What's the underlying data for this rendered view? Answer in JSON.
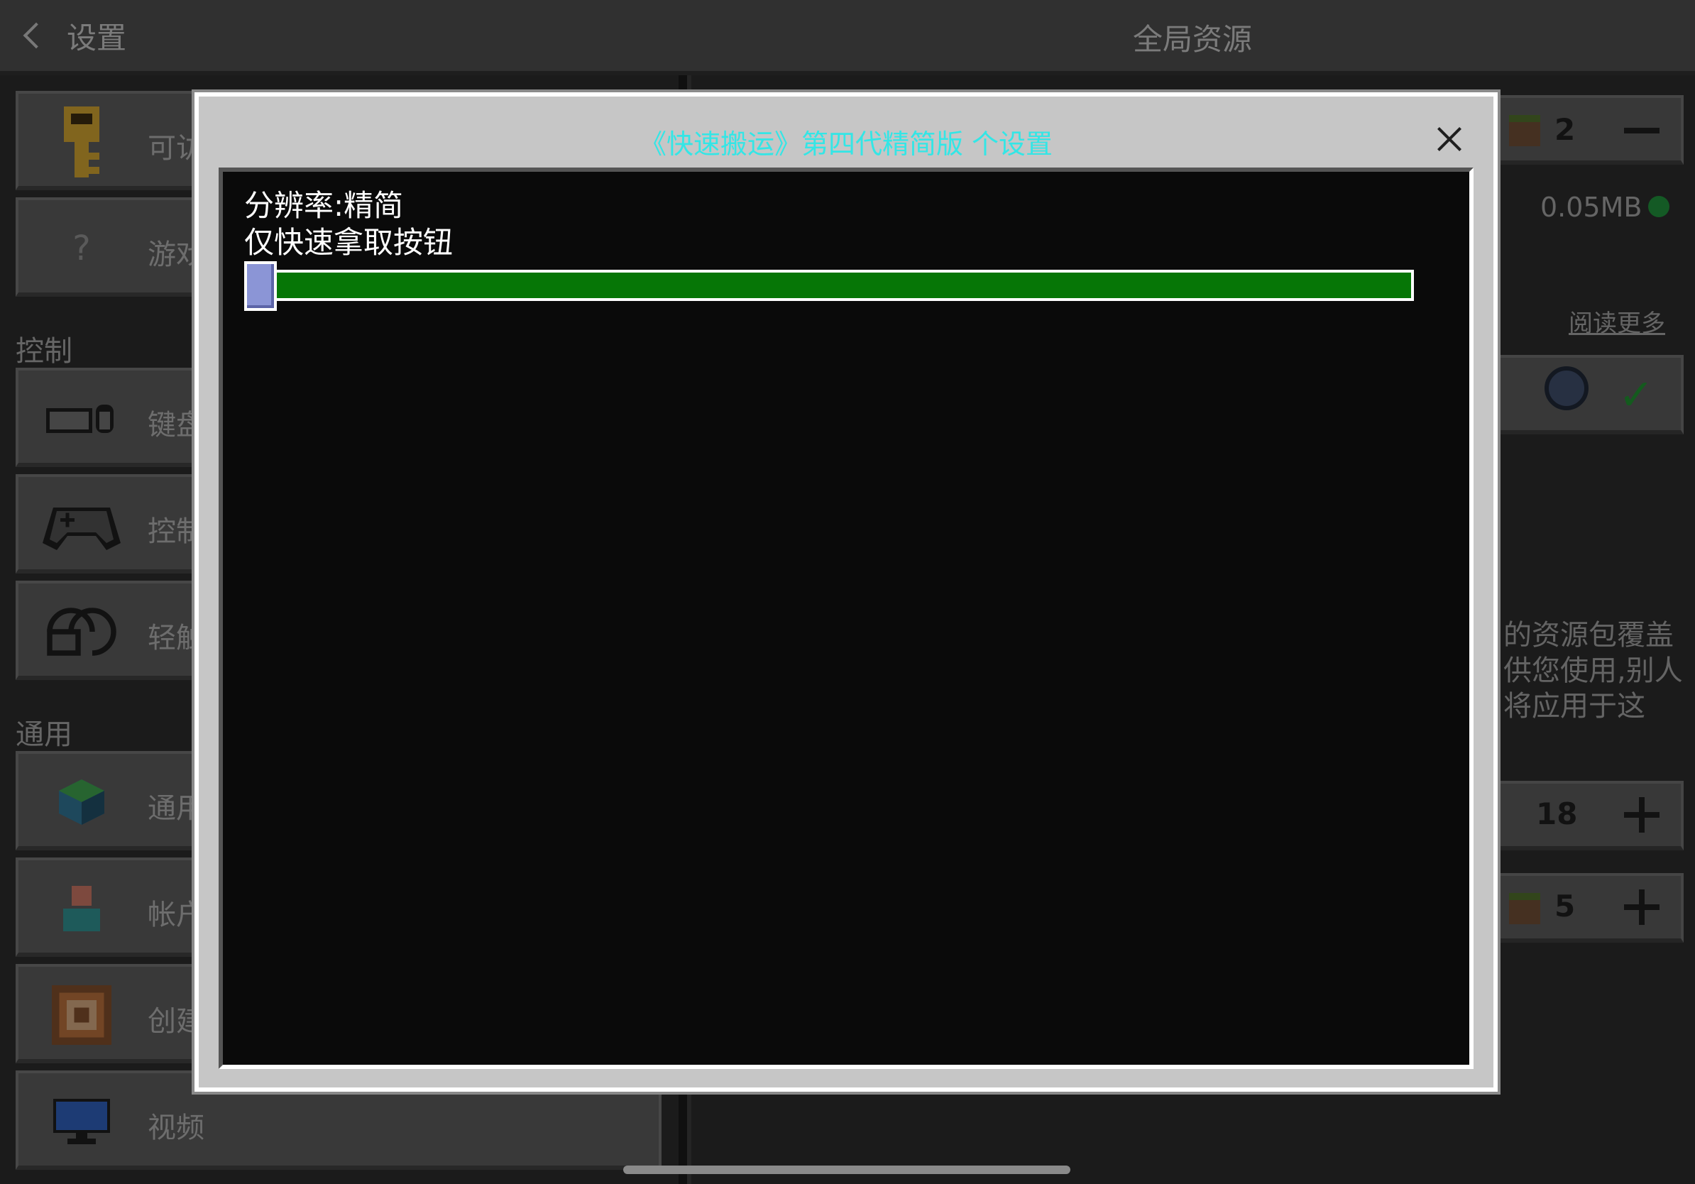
{
  "topbar": {
    "back_label": "设置",
    "title": "全局资源"
  },
  "sidebar": {
    "sections": {
      "controls": "控制",
      "general": "通用"
    },
    "items": [
      {
        "label": "可访",
        "icon": "key-icon"
      },
      {
        "label": "游戏",
        "icon": "question-icon"
      },
      {
        "label": "键盘",
        "icon": "keyboard-mouse-icon"
      },
      {
        "label": "控制",
        "icon": "gamepad-icon"
      },
      {
        "label": "轻触",
        "icon": "touch-icon"
      },
      {
        "label": "通用",
        "icon": "globe-cube-icon"
      },
      {
        "label": "帐户",
        "icon": "account-icon"
      },
      {
        "label": "创建",
        "icon": "creator-icon"
      },
      {
        "label": "视频",
        "icon": "monitor-icon"
      }
    ]
  },
  "right": {
    "pack1_count": "2",
    "size": "0.05MB",
    "read_more": "阅读更多",
    "desc_lines": [
      "的资源包覆盖",
      "供您使用,别人",
      "将应用于这"
    ],
    "pack2_count": "18",
    "pack3_count": "5"
  },
  "modal": {
    "title": "《快速搬运》第四代精简版 个设置",
    "line1": "分辨率:精简",
    "line2": "仅快速拿取按钮",
    "slider_value": 0.0,
    "colors": {
      "title": "#33e6e6",
      "track": "#067606",
      "knob": "#8b95d6"
    }
  }
}
